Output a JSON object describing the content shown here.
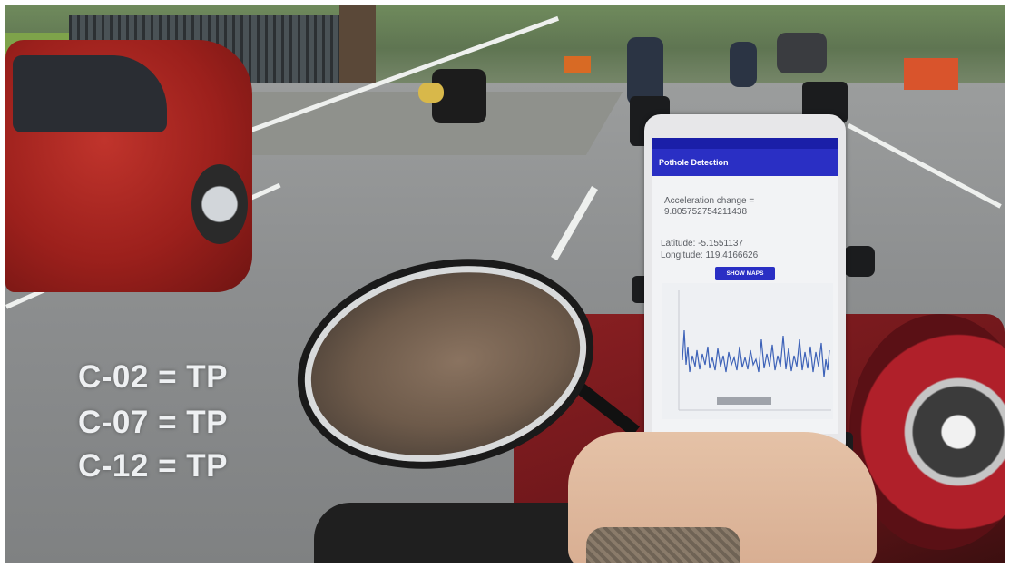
{
  "scene": {
    "description_tag": "rider-view-street"
  },
  "overlay": {
    "lines": [
      "C-02 = TP",
      "C-07 = TP",
      "C-12 = TP"
    ]
  },
  "phone_app": {
    "app_title": "Pothole Detection",
    "acceleration_label": "Acceleration change =",
    "acceleration_value": "9.805752754211438",
    "latitude_text": "Latitude: -5.1551137",
    "longitude_text": "Longitude: 119.4166626",
    "show_maps_label": "SHOW MAPS",
    "accent_color": "#2a2fc4",
    "status_bar_color": "#1a1fa8"
  }
}
